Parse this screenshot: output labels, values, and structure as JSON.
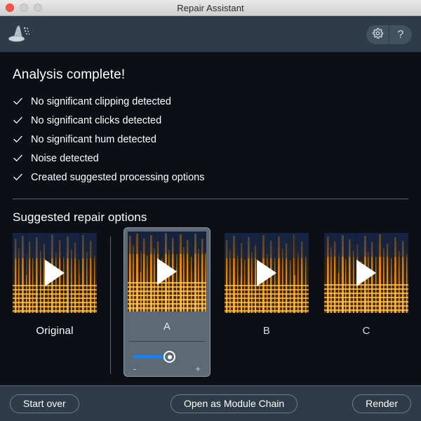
{
  "window": {
    "title": "Repair Assistant",
    "traffic_lights": [
      "close",
      "minimize",
      "maximize"
    ]
  },
  "header": {
    "logo_icon": "wizard-hat-icon",
    "settings_icon": "gear-icon",
    "help_label": "?"
  },
  "analysis": {
    "heading": "Analysis complete!",
    "items": [
      {
        "icon": "checkmark-icon",
        "label": "No significant clipping detected"
      },
      {
        "icon": "checkmark-icon",
        "label": "No significant clicks detected"
      },
      {
        "icon": "checkmark-icon",
        "label": "No significant hum detected"
      },
      {
        "icon": "checkmark-icon",
        "label": "Noise detected"
      },
      {
        "icon": "checkmark-icon",
        "label": "Created suggested processing options"
      }
    ]
  },
  "options": {
    "heading": "Suggested repair options",
    "cards": [
      {
        "label": "Original",
        "selected": false,
        "play_icon": "play-icon"
      },
      {
        "label": "A",
        "selected": true,
        "play_icon": "play-icon"
      },
      {
        "label": "B",
        "selected": false,
        "play_icon": "play-icon"
      },
      {
        "label": "C",
        "selected": false,
        "play_icon": "play-icon"
      }
    ],
    "strength_slider": {
      "value": 50,
      "min_label": "-",
      "max_label": "+",
      "accent_color": "#1a7ff0"
    }
  },
  "footer": {
    "start_over_label": "Start over",
    "open_chain_label": "Open as Module Chain",
    "render_label": "Render"
  },
  "colors": {
    "app_background": "#0c1016",
    "chrome": "#2d3c48",
    "accent_blue": "#1a7ff0",
    "selected_card": "#5d6a75",
    "text_primary": "#ffffff"
  }
}
